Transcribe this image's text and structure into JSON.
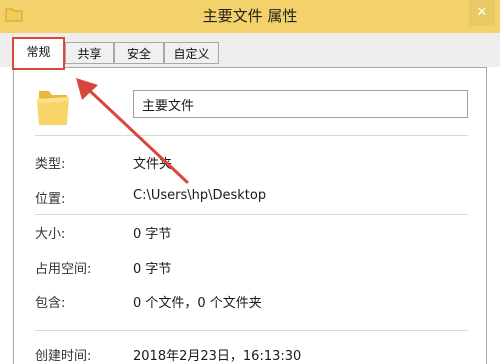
{
  "window": {
    "title": "主要文件 属性",
    "close_glyph": "✕"
  },
  "tabs": [
    {
      "label": "常规",
      "active": true
    },
    {
      "label": "共享",
      "active": false
    },
    {
      "label": "安全",
      "active": false
    },
    {
      "label": "自定义",
      "active": false
    }
  ],
  "general": {
    "name_value": "主要文件",
    "rows": [
      {
        "label": "类型:",
        "value": "文件夹"
      },
      {
        "label": "位置:",
        "value": "C:\\Users\\hp\\Desktop"
      },
      {
        "label": "大小:",
        "value": "0 字节"
      },
      {
        "label": "占用空间:",
        "value": "0 字节"
      },
      {
        "label": "包含:",
        "value": "0 个文件，0 个文件夹"
      },
      {
        "label": "创建时间:",
        "value": "2018年2月23日，16:13:30"
      }
    ]
  },
  "colors": {
    "titlebar": "#f3d26b",
    "annotation_red": "#d9463a",
    "folder_yellow": "#f5cd55"
  },
  "icons": {
    "title": "folder-icon",
    "large": "folder-icon",
    "close": "close-icon"
  }
}
